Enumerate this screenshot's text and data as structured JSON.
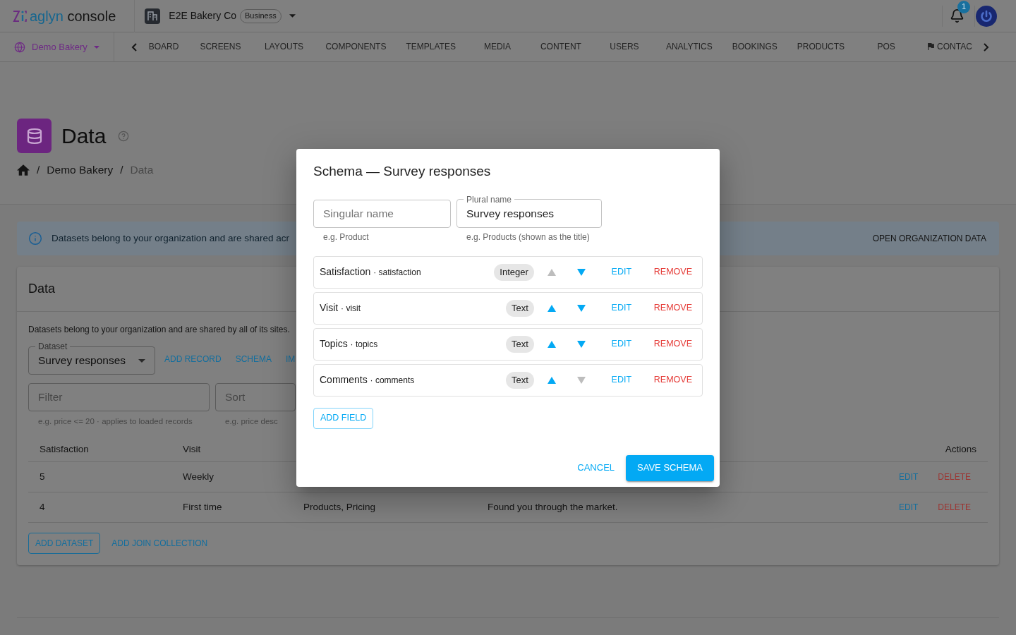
{
  "top_bar": {
    "logo": {
      "brand": "aglyn",
      "product": "console"
    },
    "organization": {
      "name": "E2E Bakery Co",
      "plan": "Business"
    },
    "notifications": {
      "count": "1"
    }
  },
  "nav": {
    "site": "Demo Bakery",
    "tabs": [
      {
        "label": "BOARD",
        "kind": "text",
        "selected": false
      },
      {
        "label": "SCREENS",
        "kind": "text",
        "selected": false
      },
      {
        "label": "LAYOUTS",
        "kind": "text",
        "selected": false
      },
      {
        "label": "COMPONENTS",
        "kind": "text",
        "selected": false
      },
      {
        "label": "TEMPLATES",
        "kind": "text",
        "selected": false
      },
      {
        "label": "MEDIA",
        "kind": "text",
        "selected": false
      },
      {
        "label": "CONTENT",
        "kind": "text",
        "selected": false
      },
      {
        "label": "USERS",
        "kind": "text",
        "selected": false
      },
      {
        "label": "ANALYTICS",
        "kind": "text",
        "selected": false
      },
      {
        "label": "BOOKINGS",
        "kind": "text",
        "selected": false
      },
      {
        "label": "PRODUCTS",
        "kind": "text",
        "selected": false
      },
      {
        "label": "POS",
        "kind": "text",
        "selected": false
      },
      {
        "label": "CONTAC",
        "kind": "icon",
        "selected": false
      }
    ]
  },
  "page_header": {
    "title": "Data",
    "breadcrumb": [
      {
        "kind": "home"
      },
      {
        "kind": "separator",
        "text": "/"
      },
      {
        "kind": "link",
        "text": "Demo Bakery"
      },
      {
        "kind": "separator",
        "text": "/"
      },
      {
        "kind": "current",
        "text": "Data"
      }
    ]
  },
  "info_banner": {
    "text": "Datasets belong to your organization and are shared acr",
    "action": "OPEN ORGANIZATION DATA"
  },
  "data_card": {
    "title": "Data",
    "description": "Datasets belong to your organization and are shared by all of its sites.",
    "dataset_select": {
      "label": "Dataset",
      "value": "Survey responses"
    },
    "actions": [
      "ADD RECORD",
      "SCHEMA",
      "IM"
    ],
    "filter": {
      "placeholder": "Filter",
      "hint": "e.g. price <= 20 · applies to loaded records"
    },
    "sort": {
      "placeholder": "Sort",
      "hint": "e.g. price desc"
    },
    "table": {
      "columns": [
        "Satisfaction",
        "Visit"
      ],
      "actions_column": "Actions",
      "rows": [
        {
          "cells": [
            "5",
            "Weekly"
          ],
          "actions": [
            {
              "label": "EDIT",
              "kind": "edit"
            },
            {
              "label": "DELETE",
              "kind": "delete"
            }
          ]
        },
        {
          "cells": [
            "4",
            "First time",
            "Products, Pricing",
            "Found you through the market."
          ],
          "actions": [
            {
              "label": "EDIT",
              "kind": "edit"
            },
            {
              "label": "DELETE",
              "kind": "delete"
            }
          ]
        }
      ]
    },
    "buttons": [
      {
        "label": "ADD DATASET",
        "kind": "outlined"
      },
      {
        "label": "ADD JOIN COLLECTION",
        "kind": "text"
      }
    ]
  },
  "dialog": {
    "title": "Schema — Survey responses",
    "singular": {
      "placeholder": "Singular name",
      "hint": "e.g. Product"
    },
    "plural": {
      "label": "Plural name",
      "value": "Survey responses",
      "hint": "e.g. Products (shown as the title)"
    },
    "fields": [
      {
        "name": "Satisfaction",
        "key": "· satisfaction",
        "type": "Integer",
        "up_disabled": true,
        "down_disabled": false,
        "actions": [
          {
            "label": "EDIT",
            "kind": "edit"
          },
          {
            "label": "REMOVE",
            "kind": "remove"
          }
        ]
      },
      {
        "name": "Visit",
        "key": "· visit",
        "type": "Text",
        "up_disabled": false,
        "down_disabled": false,
        "actions": [
          {
            "label": "EDIT",
            "kind": "edit"
          },
          {
            "label": "REMOVE",
            "kind": "remove"
          }
        ]
      },
      {
        "name": "Topics",
        "key": "· topics",
        "type": "Text",
        "up_disabled": false,
        "down_disabled": false,
        "actions": [
          {
            "label": "EDIT",
            "kind": "edit"
          },
          {
            "label": "REMOVE",
            "kind": "remove"
          }
        ]
      },
      {
        "name": "Comments",
        "key": "· comments",
        "type": "Text",
        "up_disabled": false,
        "down_disabled": true,
        "actions": [
          {
            "label": "EDIT",
            "kind": "edit"
          },
          {
            "label": "REMOVE",
            "kind": "remove"
          }
        ]
      }
    ],
    "add_field": "ADD FIELD",
    "cancel": "CANCEL",
    "save": "SAVE SCHEMA"
  }
}
